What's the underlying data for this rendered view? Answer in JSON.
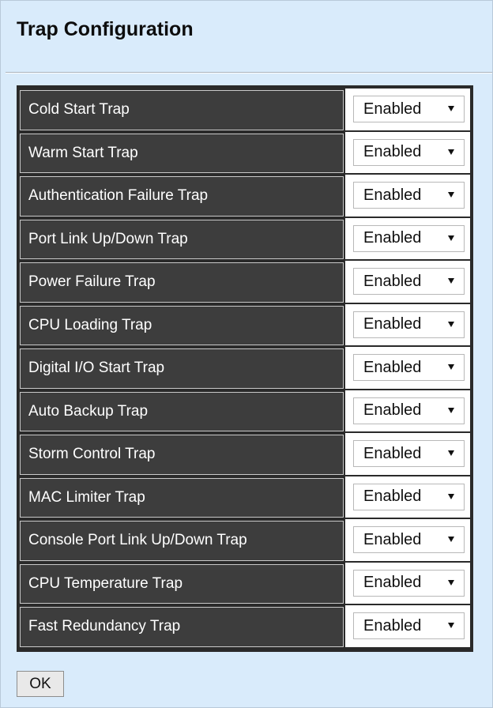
{
  "title": "Trap Configuration",
  "rows": [
    {
      "label": "Cold Start Trap",
      "value": "Enabled"
    },
    {
      "label": "Warm Start Trap",
      "value": "Enabled"
    },
    {
      "label": "Authentication Failure Trap",
      "value": "Enabled"
    },
    {
      "label": "Port Link Up/Down Trap",
      "value": "Enabled"
    },
    {
      "label": "Power Failure Trap",
      "value": "Enabled"
    },
    {
      "label": "CPU Loading Trap",
      "value": "Enabled"
    },
    {
      "label": "Digital I/O Start Trap",
      "value": "Enabled"
    },
    {
      "label": "Auto Backup Trap",
      "value": "Enabled"
    },
    {
      "label": "Storm Control Trap",
      "value": "Enabled"
    },
    {
      "label": "MAC Limiter Trap",
      "value": "Enabled"
    },
    {
      "label": "Console Port Link Up/Down Trap",
      "value": "Enabled"
    },
    {
      "label": "CPU Temperature Trap",
      "value": "Enabled"
    },
    {
      "label": "Fast Redundancy Trap",
      "value": "Enabled"
    }
  ],
  "ok_label": "OK",
  "colors": {
    "panel_bg": "#d9ebfb",
    "label_bg": "#3d3d3d",
    "grid_bg": "#2a2a2a"
  }
}
